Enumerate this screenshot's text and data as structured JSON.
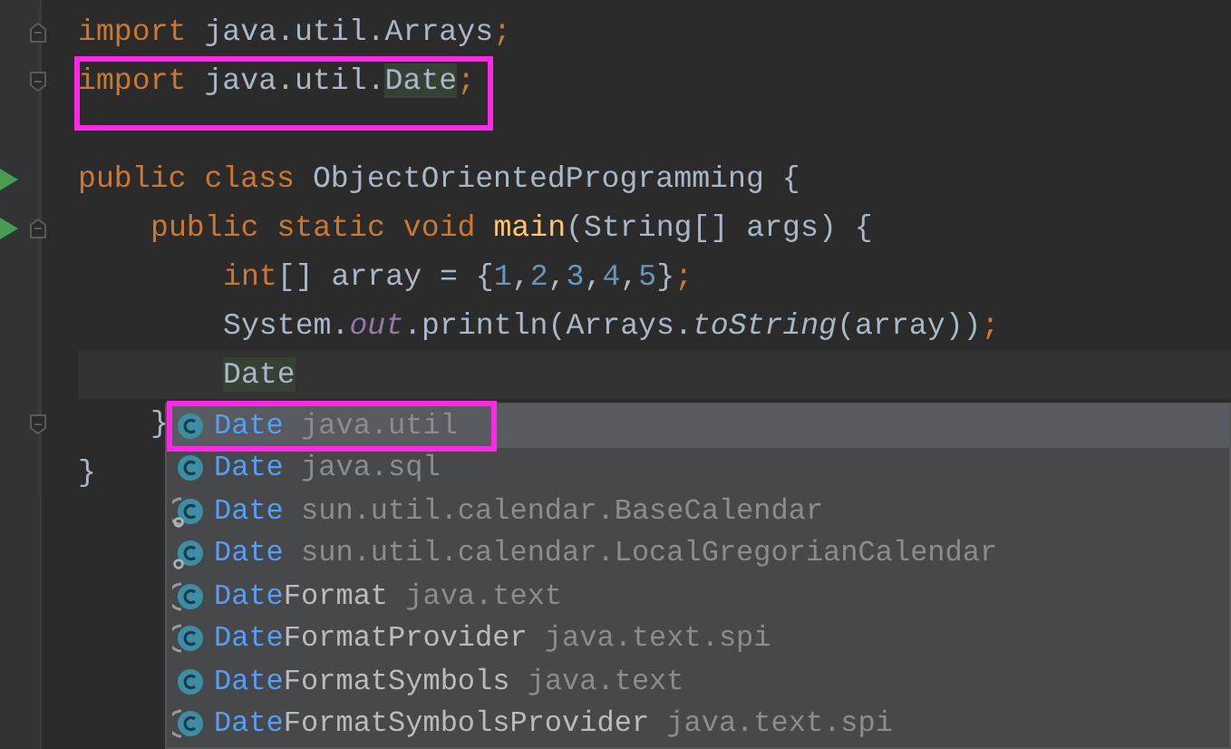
{
  "editor": {
    "imports": [
      {
        "fold_open": true,
        "tokens": [
          {
            "text": "import",
            "kind": "kw"
          },
          {
            "text": " java.util.Arrays",
            "kind": "id"
          },
          {
            "text": ";",
            "kind": "kw"
          }
        ]
      },
      {
        "fold_close": true,
        "tokens": [
          {
            "text": "import",
            "kind": "kw"
          },
          {
            "text": " java.util.",
            "kind": "id"
          },
          {
            "text": "Date",
            "kind": "match"
          },
          {
            "text": ";",
            "kind": "kw"
          }
        ]
      }
    ],
    "lines": [
      {
        "run": true,
        "tokens": [
          {
            "text": "public class",
            "kind": "kw"
          },
          {
            "text": " ObjectOrientedProgramming {",
            "kind": "id"
          }
        ],
        "children": [
          {
            "run": true,
            "fold_open": true,
            "tokens": [
              {
                "text": "public static void ",
                "kind": "kw"
              },
              {
                "text": "main",
                "kind": "fn"
              },
              {
                "text": "(String[] args) {",
                "kind": "id"
              }
            ],
            "children": [
              {
                "tokens": [
                  {
                    "text": "int",
                    "kind": "kw"
                  },
                  {
                    "text": "[] array = {",
                    "kind": "id"
                  },
                  {
                    "text": "1",
                    "kind": "num"
                  },
                  {
                    "text": ",",
                    "kind": "id"
                  },
                  {
                    "text": "2",
                    "kind": "num"
                  },
                  {
                    "text": ",",
                    "kind": "id"
                  },
                  {
                    "text": "3",
                    "kind": "num"
                  },
                  {
                    "text": ",",
                    "kind": "id"
                  },
                  {
                    "text": "4",
                    "kind": "num"
                  },
                  {
                    "text": ",",
                    "kind": "id"
                  },
                  {
                    "text": "5",
                    "kind": "num"
                  },
                  {
                    "text": "}",
                    "kind": "id"
                  },
                  {
                    "text": ";",
                    "kind": "kw"
                  }
                ]
              },
              {
                "tokens": [
                  {
                    "text": "System.",
                    "kind": "id"
                  },
                  {
                    "text": "out",
                    "kind": "field"
                  },
                  {
                    "text": ".println(Arrays.",
                    "kind": "id"
                  },
                  {
                    "text": "toString",
                    "kind": "static"
                  },
                  {
                    "text": "(array))",
                    "kind": "id"
                  },
                  {
                    "text": ";",
                    "kind": "kw"
                  }
                ]
              },
              {
                "current": true,
                "tokens": [
                  {
                    "text": "Date",
                    "kind": "match"
                  }
                ]
              }
            ]
          },
          {
            "fold_close": true,
            "tokens": [
              {
                "text": "}",
                "kind": "id"
              }
            ]
          }
        ]
      },
      {
        "tokens": [
          {
            "text": "}",
            "kind": "id"
          }
        ]
      }
    ]
  },
  "completion": {
    "items": [
      {
        "kind": "class",
        "match": "Date",
        "package": "java.util",
        "selected": true
      },
      {
        "kind": "class",
        "match": "Date",
        "package": "java.sql",
        "selected": false
      },
      {
        "kind": "abstract-gear",
        "match": "Date",
        "package": "sun.util.calendar.BaseCalendar",
        "selected": false
      },
      {
        "kind": "class-gear",
        "match": "Date",
        "package": "sun.util.calendar.LocalGregorianCalendar",
        "selected": false
      },
      {
        "kind": "abstract",
        "match": "Date",
        "rest": "Format",
        "package": "java.text",
        "selected": false
      },
      {
        "kind": "abstract",
        "match": "Date",
        "rest": "FormatProvider",
        "package": "java.text.spi",
        "selected": false
      },
      {
        "kind": "class",
        "match": "Date",
        "rest": "FormatSymbols",
        "package": "java.text",
        "selected": false
      },
      {
        "kind": "abstract",
        "match": "Date",
        "rest": "FormatSymbolsProvider",
        "package": "java.text.spi",
        "selected": false
      }
    ]
  }
}
